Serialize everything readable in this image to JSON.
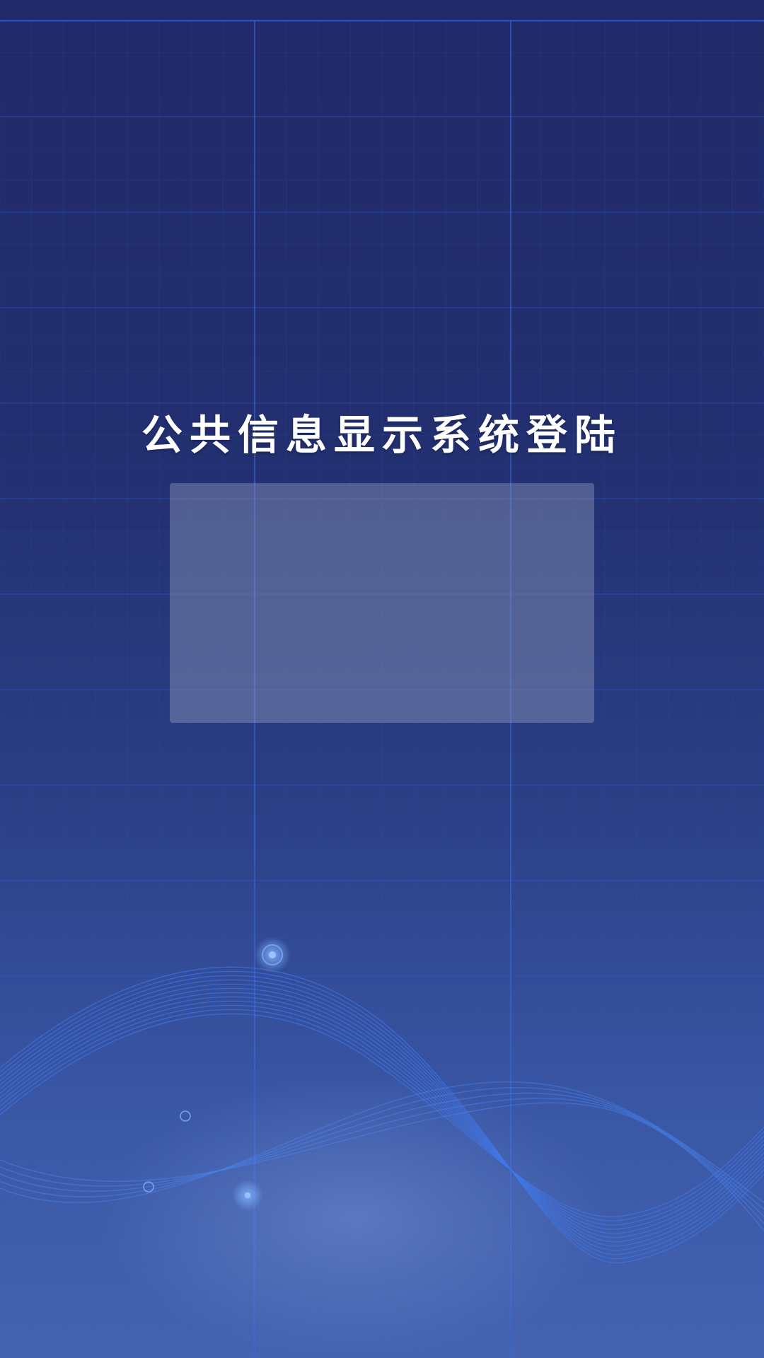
{
  "app": {
    "title": "公共信息显示系统登陆"
  },
  "login_panel": {},
  "colors": {
    "background_top": "#222a69",
    "background_bottom": "#4463b0",
    "grid_line": "#2f5ad0",
    "title_text": "#ffffff",
    "panel_fill": "#8c96b9"
  },
  "decorations": {
    "background_icon": "tech-grid-network-wave"
  }
}
